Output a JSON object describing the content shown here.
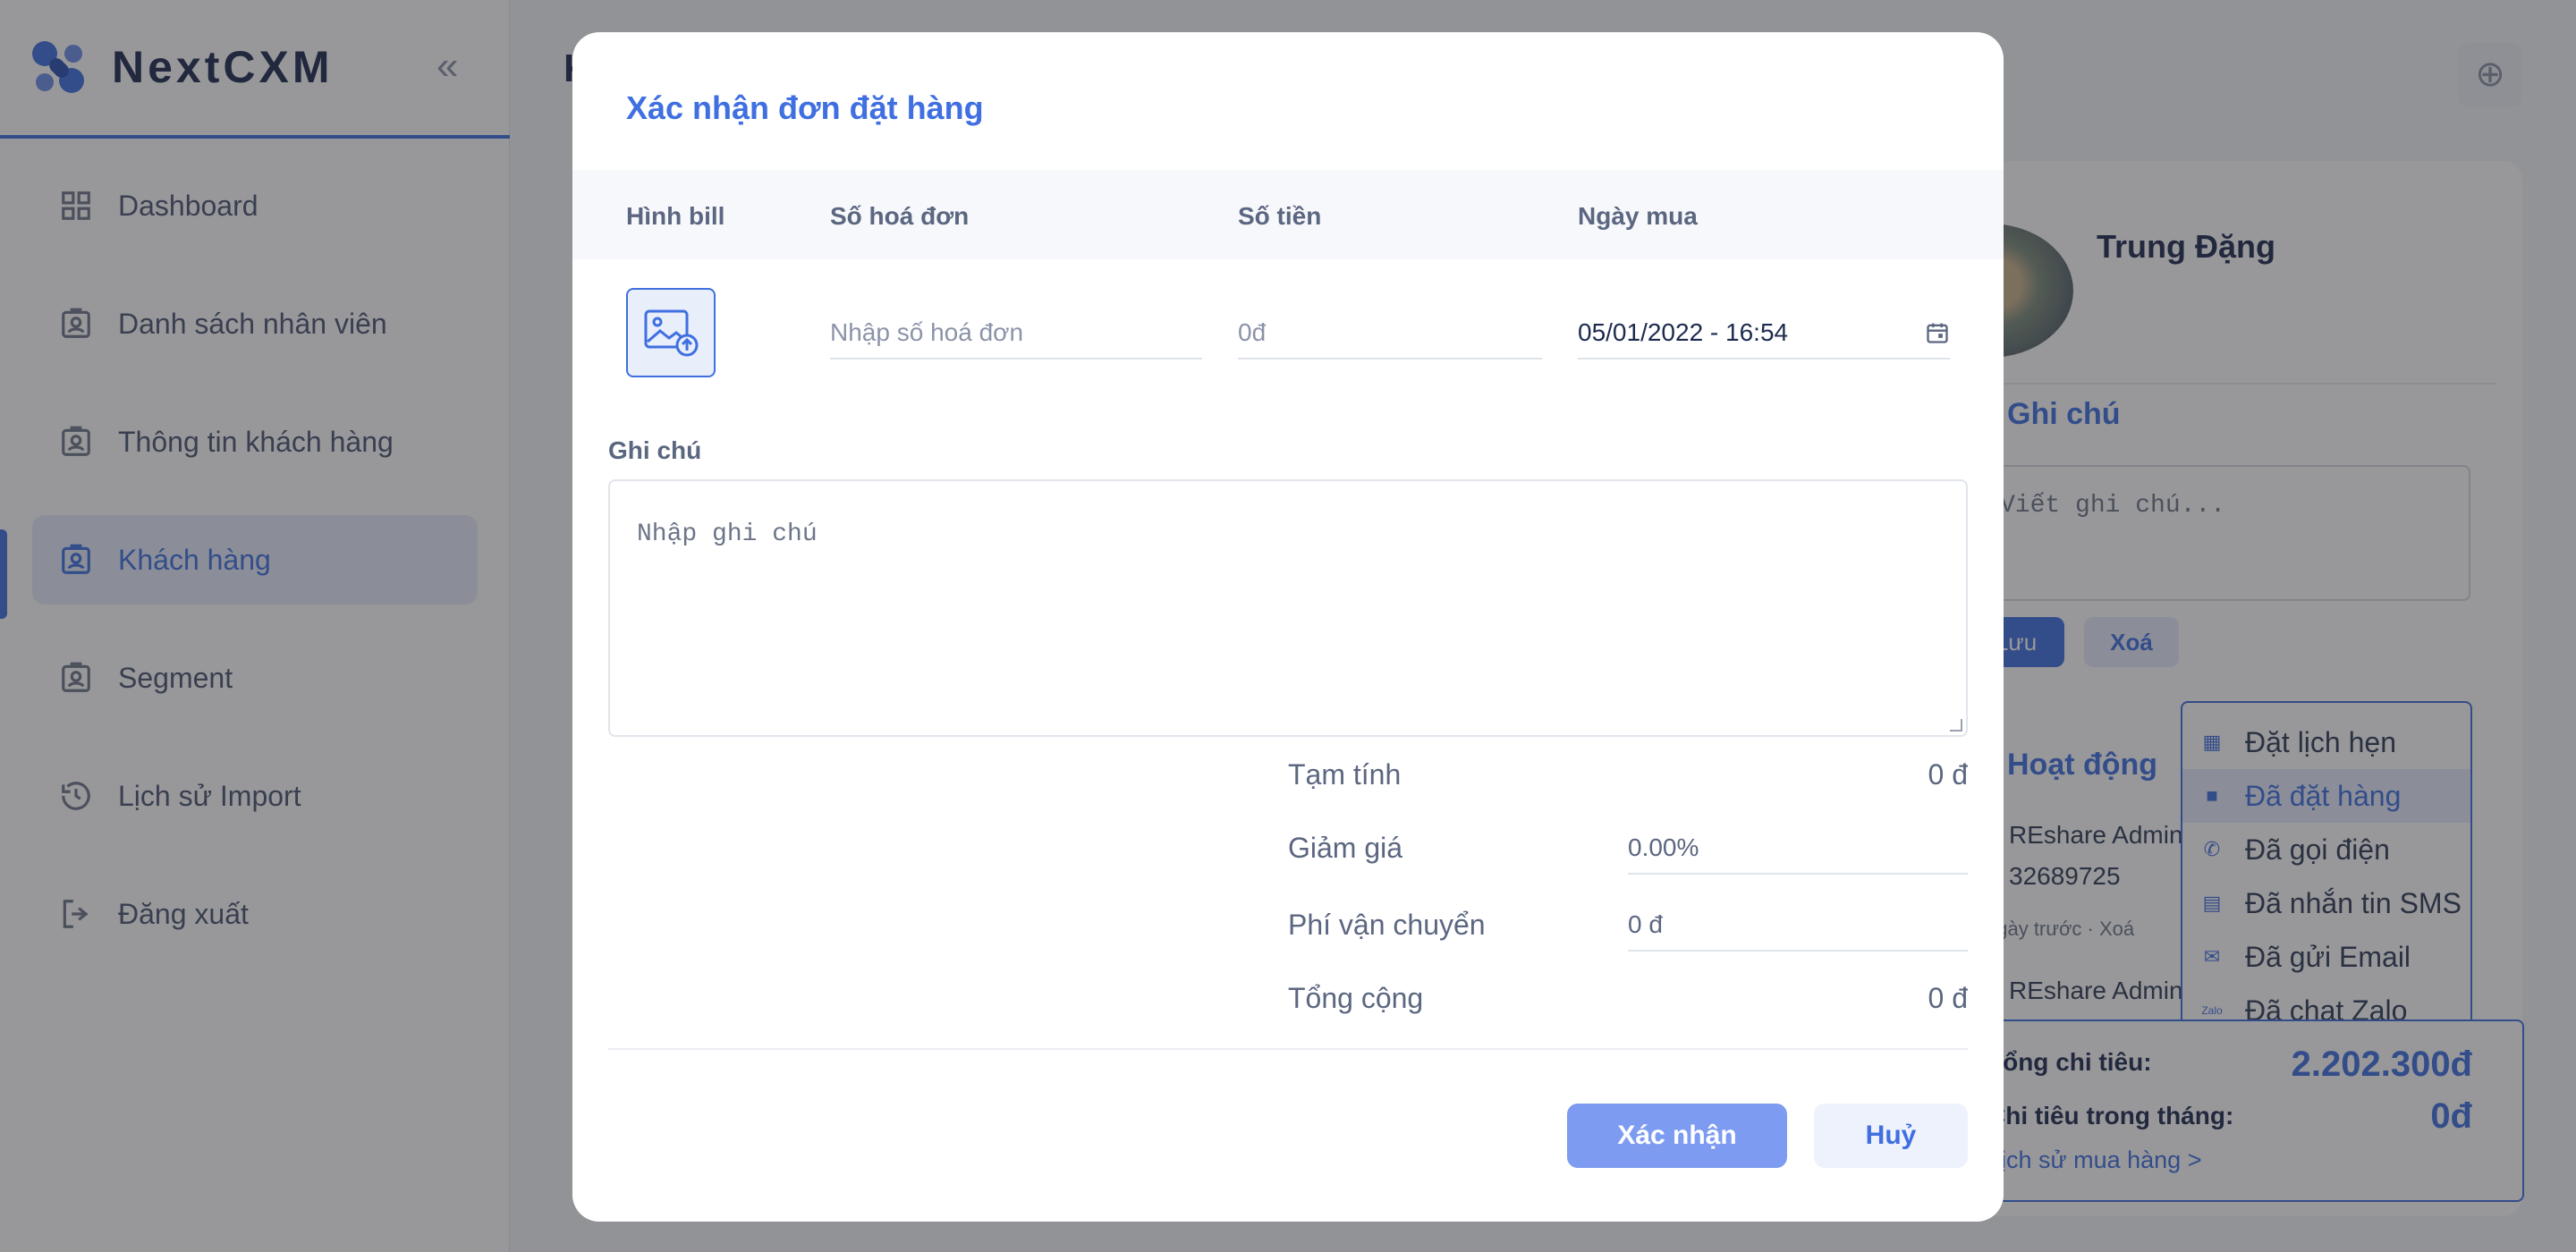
{
  "app": {
    "name": "NextCXM",
    "page_title_initial": "K"
  },
  "colors": {
    "accent": "#3f6fe0",
    "accent_light": "#e6ecfb",
    "overlay": "rgba(40,40,44,0.48)"
  },
  "sidebar": {
    "items": [
      {
        "label": "Dashboard",
        "icon": "grid-icon"
      },
      {
        "label": "Danh sách nhân viên",
        "icon": "id-badge-icon"
      },
      {
        "label": "Thông tin khách hàng",
        "icon": "id-badge-icon"
      },
      {
        "label": "Khách hàng",
        "icon": "id-badge-icon",
        "active": true
      },
      {
        "label": "Segment",
        "icon": "id-badge-icon"
      },
      {
        "label": "Lịch sử Import",
        "icon": "history-icon"
      },
      {
        "label": "Đăng xuất",
        "icon": "logout-icon"
      }
    ]
  },
  "customer_panel": {
    "name": "Trung Đặng",
    "note_title": "Ghi chú",
    "note_placeholder": "Viết ghi chú...",
    "save_label": "Lưu",
    "delete_label": "Xoá",
    "activity_title": "Hoạt động",
    "activities": [
      {
        "author": "REshare Admin",
        "detail": "32689725",
        "meta": "ngày trước · Xoá"
      },
      {
        "author": "REshare Admin"
      }
    ],
    "activity_menu": [
      {
        "label": "Đặt lịch hẹn",
        "icon": "calendar-clock-icon"
      },
      {
        "label": "Đã đặt hàng",
        "icon": "shopping-bag-icon",
        "selected": true
      },
      {
        "label": "Đã gọi điện",
        "icon": "phone-icon"
      },
      {
        "label": "Đã nhắn tin SMS",
        "icon": "sms-icon"
      },
      {
        "label": "Đã gửi Email",
        "icon": "email-icon"
      },
      {
        "label": "Đã chat Zalo",
        "icon": "zalo-icon"
      }
    ],
    "spend": {
      "total_label": "Tổng chi tiêu:",
      "total_value": "2.202.300đ",
      "month_label": "Chi tiêu trong tháng:",
      "month_value": "0đ",
      "history_link": "Lịch sử mua hàng >"
    }
  },
  "modal": {
    "title": "Xác nhận đơn đặt hàng",
    "columns": [
      "Hình bill",
      "Số hoá đơn",
      "Số tiền",
      "Ngày mua"
    ],
    "invoice_placeholder": "Nhập số hoá đơn",
    "amount_placeholder": "0đ",
    "purchase_date": "05/01/2022 - 16:54",
    "note_label": "Ghi chú",
    "note_placeholder": "Nhập ghi chú",
    "summary": {
      "subtotal_label": "Tạm tính",
      "subtotal_value": "0 đ",
      "discount_label": "Giảm giá",
      "discount_value": "0.00%",
      "shipping_label": "Phí vận chuyển",
      "shipping_value": "0 đ",
      "total_label": "Tổng cộng",
      "total_value": "0 đ"
    },
    "confirm_label": "Xác nhận",
    "cancel_label": "Huỷ"
  }
}
